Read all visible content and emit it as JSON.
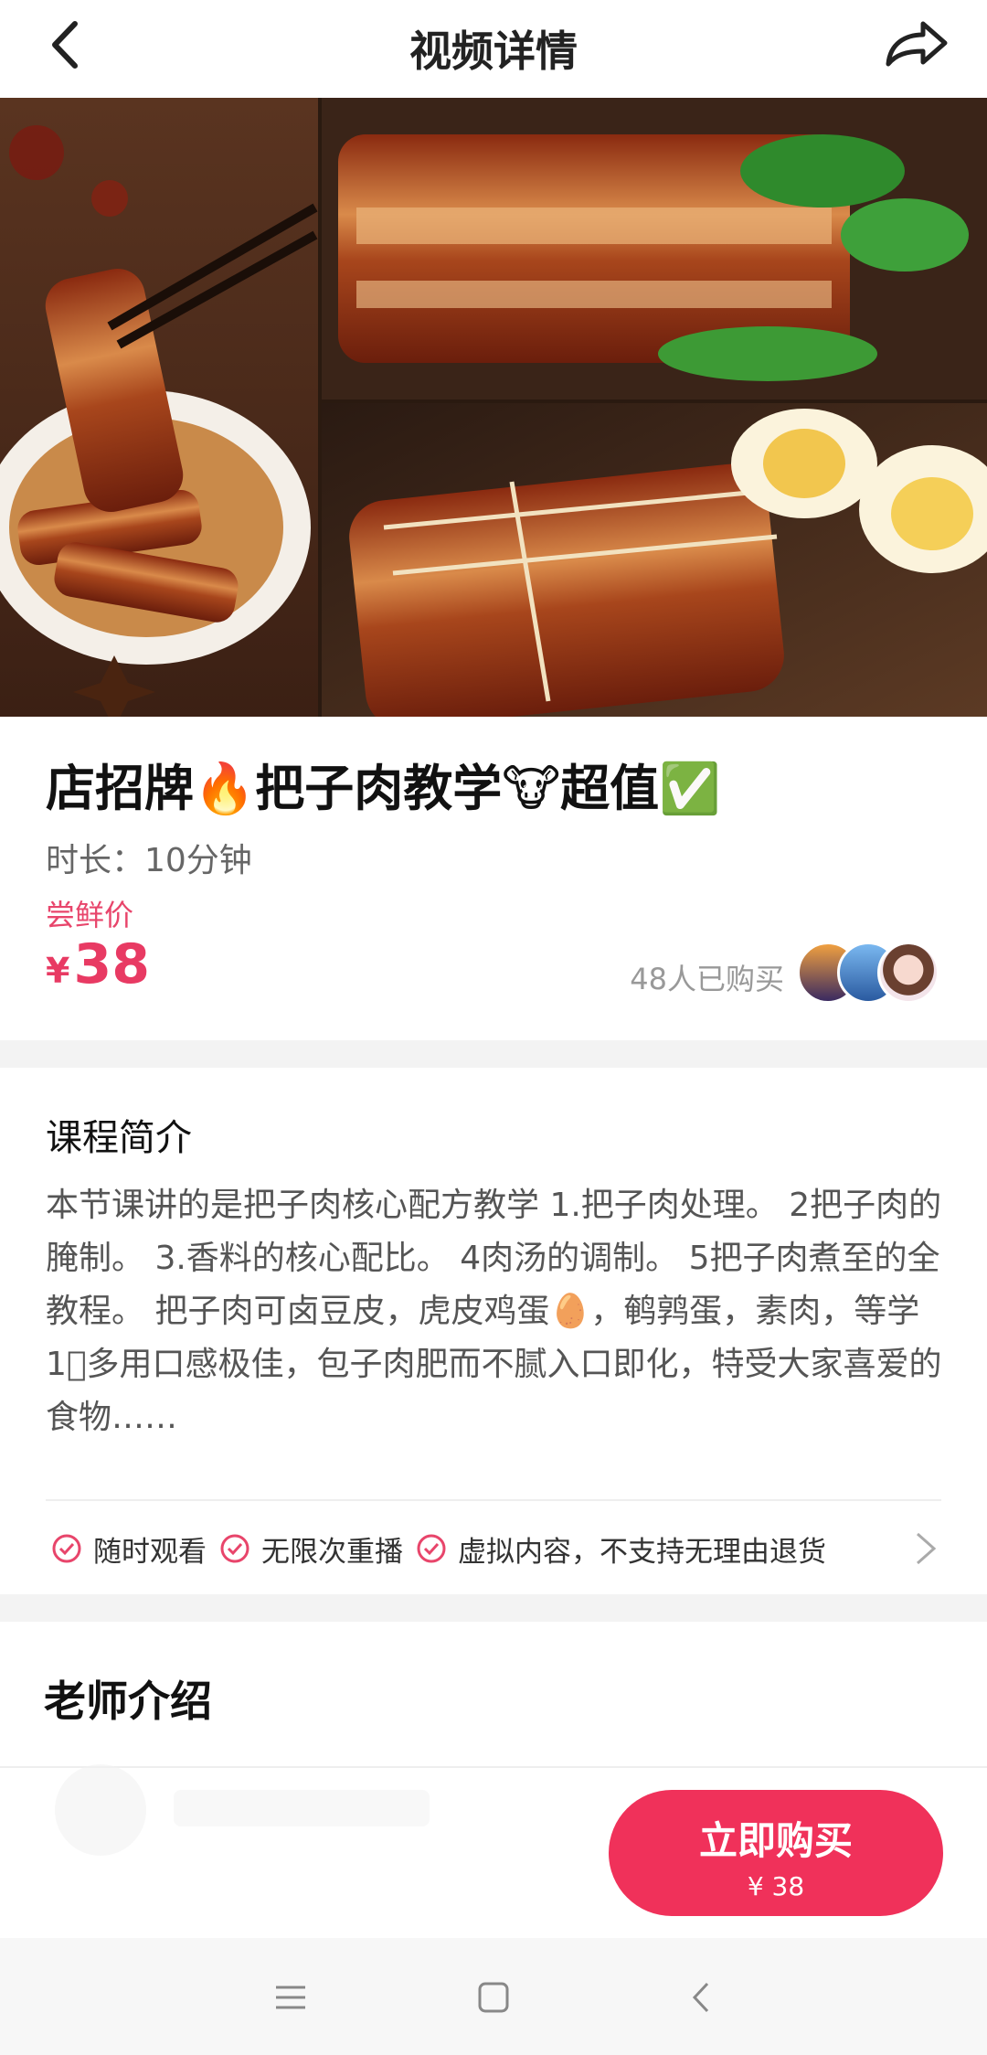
{
  "header": {
    "title": "视频详情",
    "back_icon": "chevron-left-icon",
    "share_icon": "share-arrow-icon"
  },
  "hero": {
    "description_icon": "food-collage-image"
  },
  "product": {
    "title": "店招牌🔥把子肉教学🐮超值✅",
    "duration": "时长：10分钟",
    "price_label": "尝鲜价",
    "currency": "¥",
    "price": "38",
    "buyers_text": "48人已购买"
  },
  "intro": {
    "heading": "课程简介",
    "text": "本节课讲的是把子肉核心配方教学 1.把子肉处理。 2把子肉的腌制。 3.香料的核心配比。 4肉汤的调制。 5把子肉煮至的全教程。 把子肉可卤豆皮，虎皮鸡蛋🥚，鹌鹑蛋，素肉，等学1⃣多用口感极佳，包子肉肥而不腻入口即化，特受大家喜爱的食物……",
    "guarantees": [
      "随时观看",
      "无限次重播",
      "虚拟内容，不支持无理由退货"
    ]
  },
  "teacher": {
    "heading": "老师介绍"
  },
  "purchase": {
    "button_label": "立即购买",
    "button_price": "¥ 38"
  },
  "colors": {
    "accent": "#f0315a",
    "price": "#e83a63",
    "text_muted": "#666666"
  }
}
